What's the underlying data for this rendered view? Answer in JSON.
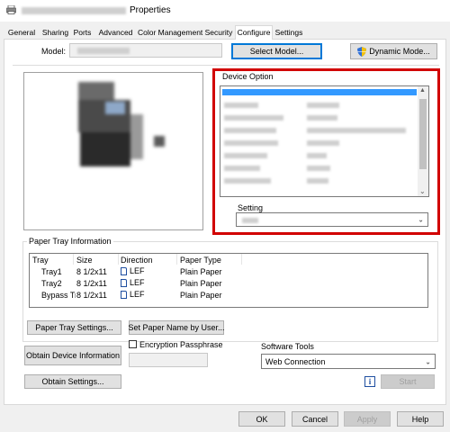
{
  "window": {
    "title": "Properties",
    "accent": "#0078d7",
    "highlight": "#d10000"
  },
  "tabs": [
    {
      "label": "General"
    },
    {
      "label": "Sharing"
    },
    {
      "label": "Ports"
    },
    {
      "label": "Advanced"
    },
    {
      "label": "Color Management"
    },
    {
      "label": "Security"
    },
    {
      "label": "Configure"
    },
    {
      "label": "Settings"
    }
  ],
  "active_tab": "Configure",
  "model": {
    "label": "Model:",
    "select_button": "Select Model...",
    "dynamic_button": "Dynamic Mode..."
  },
  "device_option": {
    "title": "Device Option",
    "setting_label": "Setting"
  },
  "paper_tray": {
    "title": "Paper Tray Information",
    "headers": [
      "Tray",
      "Size",
      "Direction",
      "Paper Type"
    ],
    "rows": [
      {
        "tray": "Tray1",
        "size": "8 1/2x11",
        "direction": "LEF",
        "type": "Plain Paper"
      },
      {
        "tray": "Tray2",
        "size": "8 1/2x11",
        "direction": "LEF",
        "type": "Plain Paper"
      },
      {
        "tray": "Bypass Tra",
        "size": "8 1/2x11",
        "direction": "LEF",
        "type": "Plain Paper"
      }
    ],
    "settings_button": "Paper Tray Settings...",
    "set_name_button": "Set Paper Name by User..."
  },
  "device_info": {
    "obtain_device_button": "Obtain Device Information",
    "encryption_label": "Encryption Passphrase",
    "obtain_settings_button": "Obtain Settings..."
  },
  "software_tools": {
    "label": "Software Tools",
    "selected": "Web Connection",
    "info_icon": "i",
    "start_button": "Start"
  },
  "footer": {
    "ok": "OK",
    "cancel": "Cancel",
    "apply": "Apply",
    "help": "Help"
  }
}
